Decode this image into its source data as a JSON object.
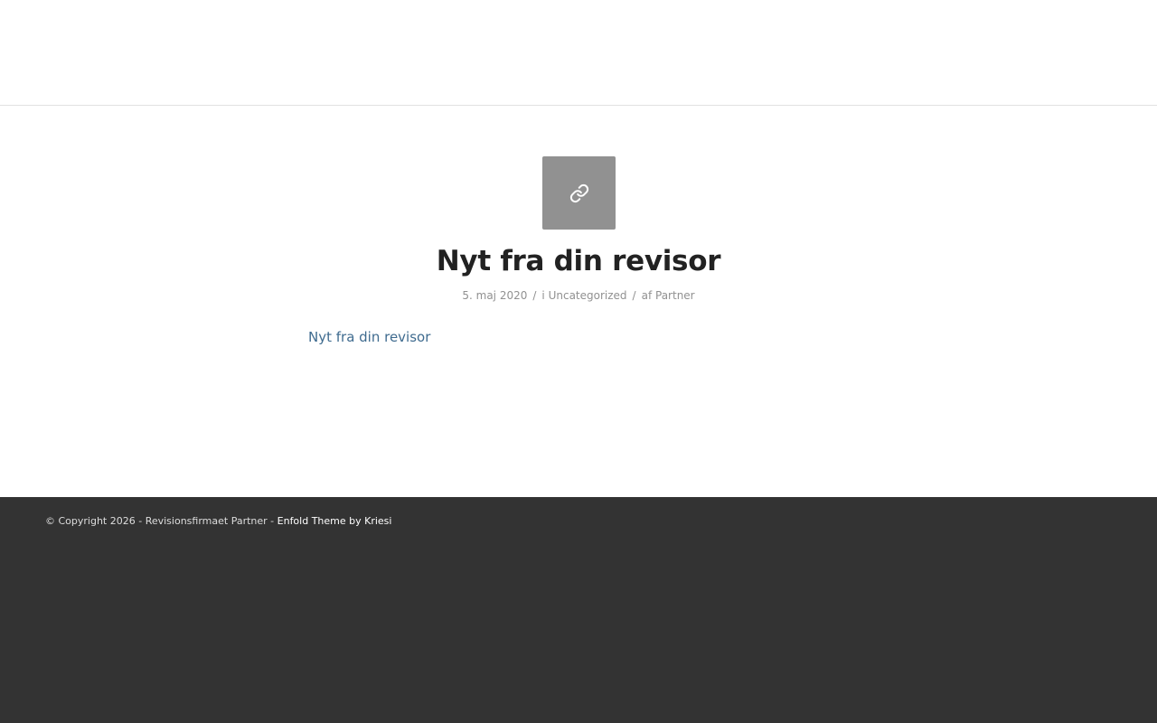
{
  "post": {
    "format_icon": "link-icon",
    "title": "Nyt fra din revisor",
    "meta": {
      "date": "5. maj 2020",
      "separator": "/",
      "category_prefix": "i",
      "category": "Uncategorized",
      "author_prefix": "af",
      "author": "Partner"
    },
    "link_text": "Nyt fra din revisor"
  },
  "footer": {
    "copyright_text": "© Copyright 2026 - Revisionsfirmaet Partner -",
    "theme_link": "Enfold Theme by Kriesi"
  },
  "colors": {
    "footer_bg": "#333333",
    "icon_bg": "#919191",
    "link": "#3f6b8f",
    "title": "#222222"
  }
}
